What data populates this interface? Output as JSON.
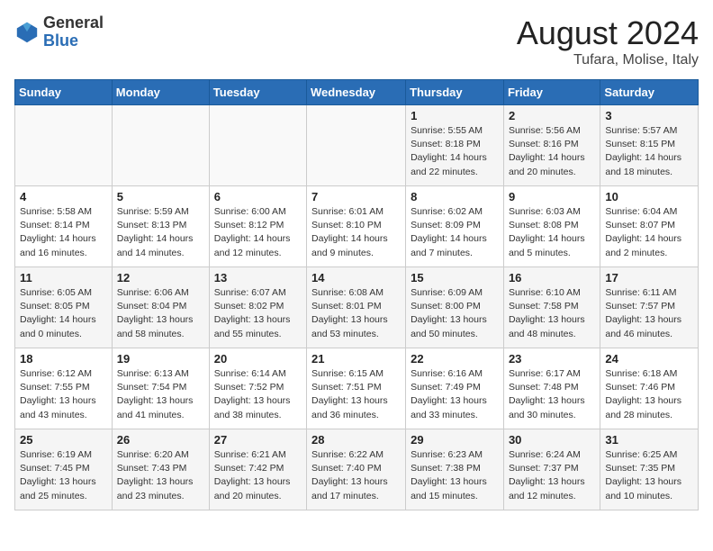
{
  "header": {
    "logo_general": "General",
    "logo_blue": "Blue",
    "main_title": "August 2024",
    "subtitle": "Tufara, Molise, Italy"
  },
  "calendar": {
    "headers": [
      "Sunday",
      "Monday",
      "Tuesday",
      "Wednesday",
      "Thursday",
      "Friday",
      "Saturday"
    ],
    "rows": [
      [
        {
          "day": "",
          "info": ""
        },
        {
          "day": "",
          "info": ""
        },
        {
          "day": "",
          "info": ""
        },
        {
          "day": "",
          "info": ""
        },
        {
          "day": "1",
          "info": "Sunrise: 5:55 AM\nSunset: 8:18 PM\nDaylight: 14 hours\nand 22 minutes."
        },
        {
          "day": "2",
          "info": "Sunrise: 5:56 AM\nSunset: 8:16 PM\nDaylight: 14 hours\nand 20 minutes."
        },
        {
          "day": "3",
          "info": "Sunrise: 5:57 AM\nSunset: 8:15 PM\nDaylight: 14 hours\nand 18 minutes."
        }
      ],
      [
        {
          "day": "4",
          "info": "Sunrise: 5:58 AM\nSunset: 8:14 PM\nDaylight: 14 hours\nand 16 minutes."
        },
        {
          "day": "5",
          "info": "Sunrise: 5:59 AM\nSunset: 8:13 PM\nDaylight: 14 hours\nand 14 minutes."
        },
        {
          "day": "6",
          "info": "Sunrise: 6:00 AM\nSunset: 8:12 PM\nDaylight: 14 hours\nand 12 minutes."
        },
        {
          "day": "7",
          "info": "Sunrise: 6:01 AM\nSunset: 8:10 PM\nDaylight: 14 hours\nand 9 minutes."
        },
        {
          "day": "8",
          "info": "Sunrise: 6:02 AM\nSunset: 8:09 PM\nDaylight: 14 hours\nand 7 minutes."
        },
        {
          "day": "9",
          "info": "Sunrise: 6:03 AM\nSunset: 8:08 PM\nDaylight: 14 hours\nand 5 minutes."
        },
        {
          "day": "10",
          "info": "Sunrise: 6:04 AM\nSunset: 8:07 PM\nDaylight: 14 hours\nand 2 minutes."
        }
      ],
      [
        {
          "day": "11",
          "info": "Sunrise: 6:05 AM\nSunset: 8:05 PM\nDaylight: 14 hours\nand 0 minutes."
        },
        {
          "day": "12",
          "info": "Sunrise: 6:06 AM\nSunset: 8:04 PM\nDaylight: 13 hours\nand 58 minutes."
        },
        {
          "day": "13",
          "info": "Sunrise: 6:07 AM\nSunset: 8:02 PM\nDaylight: 13 hours\nand 55 minutes."
        },
        {
          "day": "14",
          "info": "Sunrise: 6:08 AM\nSunset: 8:01 PM\nDaylight: 13 hours\nand 53 minutes."
        },
        {
          "day": "15",
          "info": "Sunrise: 6:09 AM\nSunset: 8:00 PM\nDaylight: 13 hours\nand 50 minutes."
        },
        {
          "day": "16",
          "info": "Sunrise: 6:10 AM\nSunset: 7:58 PM\nDaylight: 13 hours\nand 48 minutes."
        },
        {
          "day": "17",
          "info": "Sunrise: 6:11 AM\nSunset: 7:57 PM\nDaylight: 13 hours\nand 46 minutes."
        }
      ],
      [
        {
          "day": "18",
          "info": "Sunrise: 6:12 AM\nSunset: 7:55 PM\nDaylight: 13 hours\nand 43 minutes."
        },
        {
          "day": "19",
          "info": "Sunrise: 6:13 AM\nSunset: 7:54 PM\nDaylight: 13 hours\nand 41 minutes."
        },
        {
          "day": "20",
          "info": "Sunrise: 6:14 AM\nSunset: 7:52 PM\nDaylight: 13 hours\nand 38 minutes."
        },
        {
          "day": "21",
          "info": "Sunrise: 6:15 AM\nSunset: 7:51 PM\nDaylight: 13 hours\nand 36 minutes."
        },
        {
          "day": "22",
          "info": "Sunrise: 6:16 AM\nSunset: 7:49 PM\nDaylight: 13 hours\nand 33 minutes."
        },
        {
          "day": "23",
          "info": "Sunrise: 6:17 AM\nSunset: 7:48 PM\nDaylight: 13 hours\nand 30 minutes."
        },
        {
          "day": "24",
          "info": "Sunrise: 6:18 AM\nSunset: 7:46 PM\nDaylight: 13 hours\nand 28 minutes."
        }
      ],
      [
        {
          "day": "25",
          "info": "Sunrise: 6:19 AM\nSunset: 7:45 PM\nDaylight: 13 hours\nand 25 minutes."
        },
        {
          "day": "26",
          "info": "Sunrise: 6:20 AM\nSunset: 7:43 PM\nDaylight: 13 hours\nand 23 minutes."
        },
        {
          "day": "27",
          "info": "Sunrise: 6:21 AM\nSunset: 7:42 PM\nDaylight: 13 hours\nand 20 minutes."
        },
        {
          "day": "28",
          "info": "Sunrise: 6:22 AM\nSunset: 7:40 PM\nDaylight: 13 hours\nand 17 minutes."
        },
        {
          "day": "29",
          "info": "Sunrise: 6:23 AM\nSunset: 7:38 PM\nDaylight: 13 hours\nand 15 minutes."
        },
        {
          "day": "30",
          "info": "Sunrise: 6:24 AM\nSunset: 7:37 PM\nDaylight: 13 hours\nand 12 minutes."
        },
        {
          "day": "31",
          "info": "Sunrise: 6:25 AM\nSunset: 7:35 PM\nDaylight: 13 hours\nand 10 minutes."
        }
      ]
    ]
  }
}
